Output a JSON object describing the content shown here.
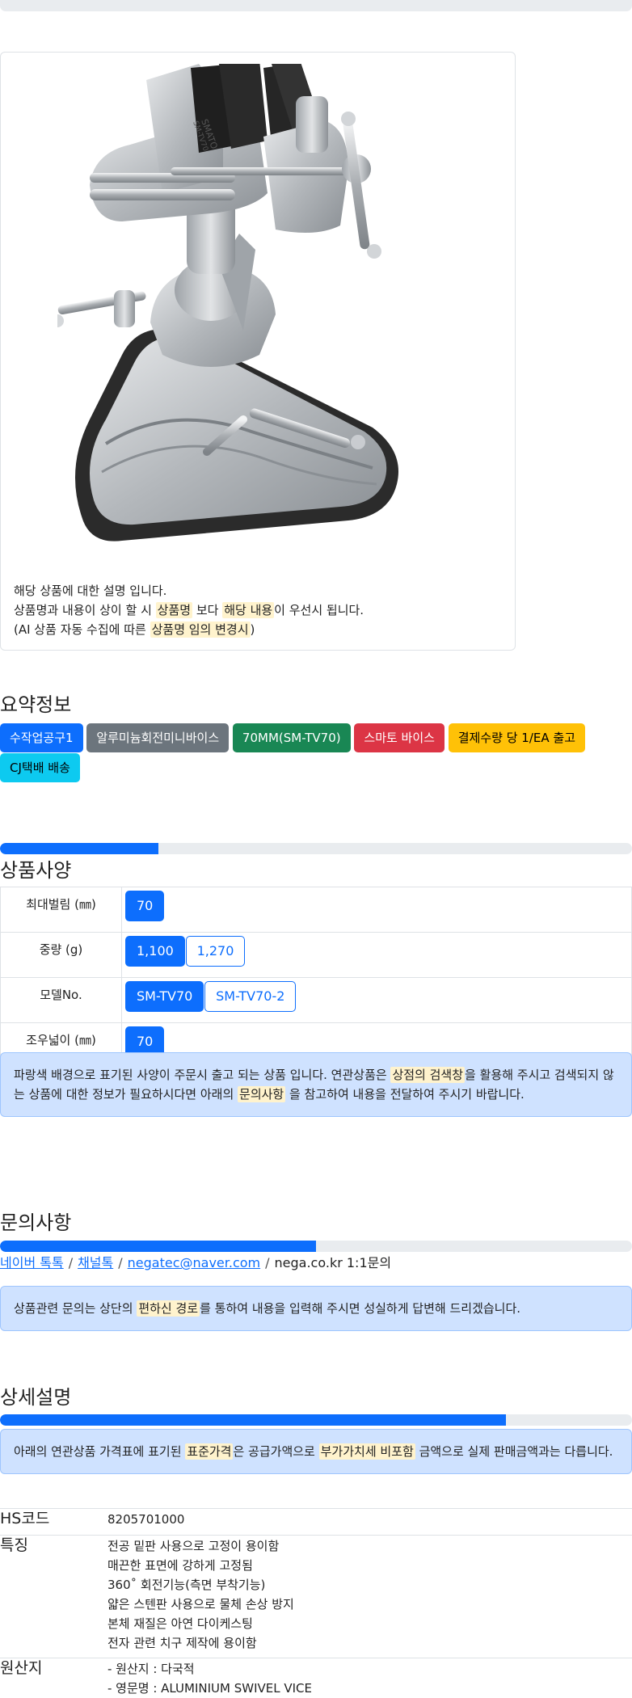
{
  "card": {
    "line1": "해당 상품에 대한 설명 입니다.",
    "line2_a": "상품명과 내용이 상이 할 시 ",
    "line2_hl1": "상품명",
    "line2_b": " 보다 ",
    "line2_hl2": "해당 내용",
    "line2_c": "이 우선시 됩니다.",
    "line3_a": "(AI 상품 자동 수집에 따른 ",
    "line3_hl": "상품명 임의 변경시",
    "line3_b": ")"
  },
  "summary": {
    "title": "요약정보",
    "tags": [
      {
        "label": "수작업공구1",
        "color": "#0d6efd",
        "text": "#ffffff"
      },
      {
        "label": "알루미늄회전미니바이스",
        "color": "#6c757d",
        "text": "#ffffff"
      },
      {
        "label": "70MM(SM-TV70)",
        "color": "#198754",
        "text": "#ffffff"
      },
      {
        "label": "스마토 바이스",
        "color": "#dc3545",
        "text": "#ffffff"
      },
      {
        "label": "결제수량 당 1/EA 출고",
        "color": "#ffc107",
        "text": "#000000"
      },
      {
        "label": "CJ택배 배송",
        "color": "#0dcaf0",
        "text": "#000000"
      }
    ]
  },
  "spec": {
    "title": "상품사양",
    "progress": 0.25,
    "rows": [
      {
        "key": "최대벌림 (㎜)",
        "values": [
          {
            "v": "70",
            "on": true
          }
        ]
      },
      {
        "key": "중량 (g)",
        "values": [
          {
            "v": "1,100",
            "on": true
          },
          {
            "v": "1,270",
            "on": false
          }
        ]
      },
      {
        "key": "모델No.",
        "values": [
          {
            "v": "SM-TV70",
            "on": true
          },
          {
            "v": "SM-TV70-2",
            "on": false
          }
        ]
      },
      {
        "key": "조우넓이 (㎜)",
        "values": [
          {
            "v": "70",
            "on": true
          }
        ]
      }
    ],
    "notice_a": "파랑색 배경으로 표기된 사양이 주문시 출고 되는 상품 입니다. 연관상품은 ",
    "notice_hl1": "상점의 검색창",
    "notice_b": "을 활용해 주시고 검색되지 않는 상품에 대한 정보가 필요하시다면 아래의 ",
    "notice_hl2": "문의사항",
    "notice_c": " 을 참고하여 내용을 전달하여 주시기 바랍니다."
  },
  "inquiry": {
    "title": "문의사항",
    "progress": 0.5,
    "link1": "네이버 톡톡",
    "link2": "채널톡",
    "link3": "negatec@naver.com",
    "text4": "nega.co.kr 1:1문의",
    "notice_a": "상품관련 문의는 상단의 ",
    "notice_hl": "편하신 경로",
    "notice_b": "를 통하여 내용을 입력해 주시면 성실하게 답변해 드리겠습니다."
  },
  "detail": {
    "title": "상세설명",
    "progress": 0.8,
    "notice_a": "아래의 연관상품 가격표에 표기된 ",
    "notice_hl1": "표준가격",
    "notice_b": "은 공급가액으로 ",
    "notice_hl2": "부가가치세 비포함",
    "notice_c": " 금액으로 실제 판매금액과는 다릅니다.",
    "hs_key": "HS코드",
    "hs_value": "8205701000",
    "feature_key": "특징",
    "features": [
      "전공 밑판 사용으로 고정이 용이함",
      "매끈한 표면에 강하게 고정됨",
      "360˚ 회전기능(측면 부착기능)",
      "얇은 스텐판 사용으로 물체 손상 방지",
      "본체 재질은 아연 다이케스팅",
      "전자 관련 치구 제작에 용이함"
    ],
    "origin_key": "원산지",
    "origins": [
      "- 원산지 : 다국적",
      "- 영문명 : ALUMINIUM SWIVEL VICE"
    ]
  },
  "image": {
    "brand_text": "SMATO",
    "model_text": "SM-TV70"
  }
}
